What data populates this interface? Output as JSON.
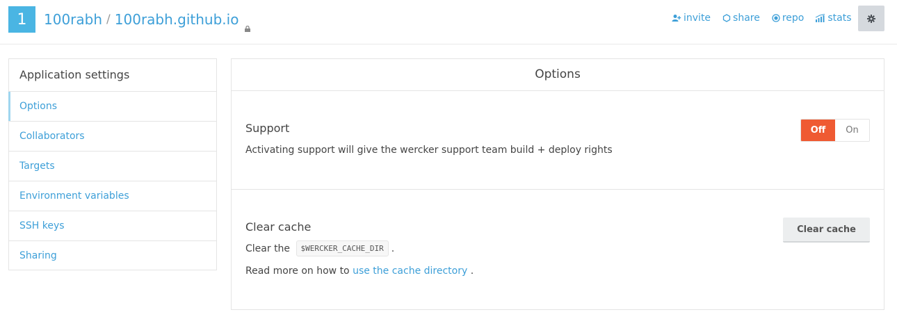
{
  "header": {
    "app_number": "1",
    "owner": "100rabh",
    "separator": "/",
    "repo": "100rabh.github.io",
    "nav": [
      {
        "label": "invite",
        "icon": "add-user-icon"
      },
      {
        "label": "share",
        "icon": "share-icon"
      },
      {
        "label": "repo",
        "icon": "repo-icon"
      },
      {
        "label": "stats",
        "icon": "stats-icon"
      }
    ],
    "settings_icon": "gear-icon"
  },
  "sidebar": {
    "title": "Application settings",
    "items": [
      {
        "label": "Options",
        "active": true
      },
      {
        "label": "Collaborators"
      },
      {
        "label": "Targets"
      },
      {
        "label": "Environment variables"
      },
      {
        "label": "SSH keys"
      },
      {
        "label": "Sharing"
      }
    ]
  },
  "panel": {
    "title": "Options",
    "support": {
      "title": "Support",
      "description": "Activating support will give the wercker support team build + deploy rights",
      "toggle_off": "Off",
      "toggle_on": "On",
      "state": "Off"
    },
    "cache": {
      "title": "Clear cache",
      "line1_prefix": "Clear the",
      "line1_code": "$WERCKER_CACHE_DIR",
      "line1_suffix": ".",
      "line2_prefix": "Read more on how to",
      "line2_link": "use the cache directory",
      "line2_suffix": ".",
      "button": "Clear cache"
    }
  },
  "colors": {
    "accent": "#3d9fd8",
    "badge": "#4ab5e3",
    "toggle_off": "#ef5a32"
  }
}
